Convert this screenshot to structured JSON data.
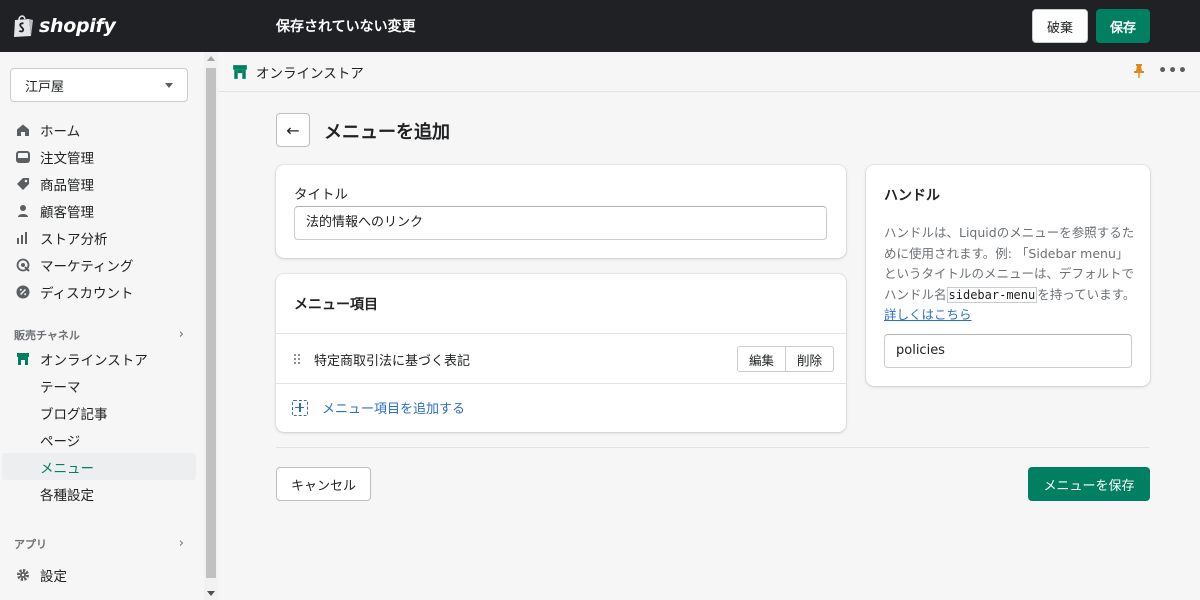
{
  "topbar": {
    "logo_text": "shopify",
    "unsaved_message": "保存されていない変更",
    "discard_label": "破棄",
    "save_label": "保存"
  },
  "sidebar": {
    "store_name": "江戸屋",
    "items": [
      {
        "label": "ホーム",
        "icon": "home-icon"
      },
      {
        "label": "注文管理",
        "icon": "orders-icon"
      },
      {
        "label": "商品管理",
        "icon": "tag-icon"
      },
      {
        "label": "顧客管理",
        "icon": "person-icon"
      },
      {
        "label": "ストア分析",
        "icon": "analytics-icon"
      },
      {
        "label": "マーケティング",
        "icon": "marketing-icon"
      },
      {
        "label": "ディスカウント",
        "icon": "discount-icon"
      }
    ],
    "sales_channels_label": "販売チャネル",
    "online_store_label": "オンラインストア",
    "sub_items": [
      "テーマ",
      "ブログ記事",
      "ページ",
      "メニュー",
      "各種設定"
    ],
    "active_sub_item": "メニュー",
    "apps_label": "アプリ",
    "settings_label": "設定"
  },
  "appbar": {
    "title": "オンラインストア"
  },
  "page": {
    "title": "メニューを追加",
    "title_field": {
      "label": "タイトル",
      "value": "法的情報へのリンク"
    },
    "menu_items": {
      "heading": "メニュー項目",
      "items": [
        {
          "label": "特定商取引法に基づく表記",
          "edit_label": "編集",
          "delete_label": "削除"
        }
      ],
      "add_label": "メニュー項目を追加する"
    },
    "handle": {
      "heading": "ハンドル",
      "desc_part1": "ハンドルは、Liquidのメニューを参照するために使用されます。例: 「Sidebar menu」というタイトルのメニューは、デフォルトでハンドル名",
      "desc_code": "sidebar-menu",
      "desc_part2": "を持っています。",
      "link_label": "詳しくはこちら",
      "value": "policies"
    },
    "cancel_label": "キャンセル",
    "save_menu_label": "メニューを保存"
  },
  "colors": {
    "primary": "#008060",
    "topbar": "#1f2124",
    "link": "#2c6ecb"
  }
}
